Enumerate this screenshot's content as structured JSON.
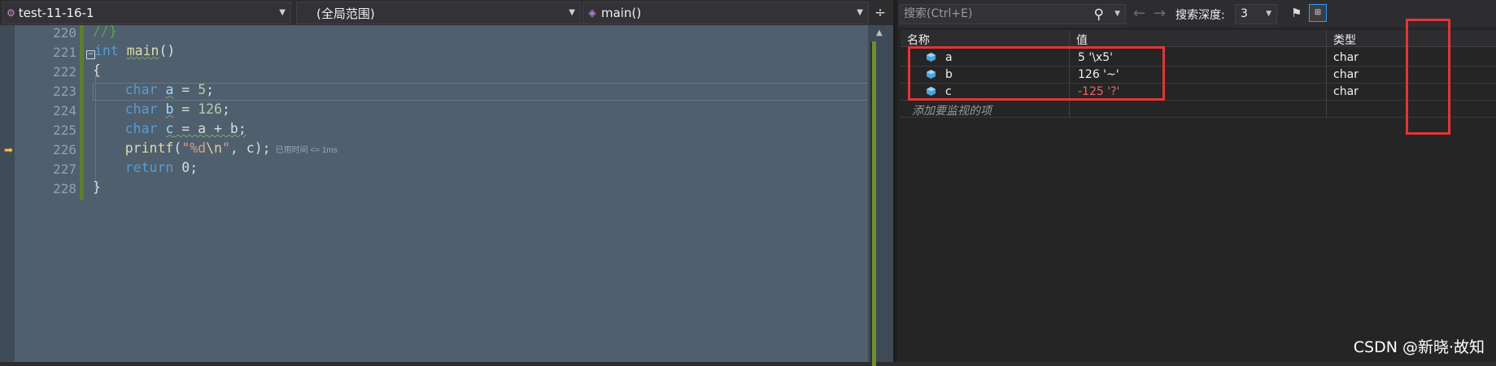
{
  "editor": {
    "project_combo": "test-11-16-1",
    "scope_combo": "(全局范围)",
    "function_combo": "main()",
    "line_numbers": [
      "220",
      "221",
      "222",
      "223",
      "224",
      "225",
      "226",
      "227",
      "228"
    ],
    "lines": {
      "l220": "//}",
      "l221_kw": "int",
      "l221_fn": "main",
      "l221_rest": "()",
      "l222": "{",
      "type_char": "char",
      "l223_var": "a",
      "l223_op": " = ",
      "l223_num": "5",
      "l224_var": "b",
      "l224_num": "126",
      "l225_var": "c",
      "l225_expr": " = a + b;",
      "l226_fn": "printf",
      "l226_open": "(",
      "l226_str1": "\"%d",
      "l226_esc": "\\n",
      "l226_str2": "\"",
      "l226_rest": ", c);",
      "l226_hint": "已用时间 <= 1ms",
      "l227_kw": "return",
      "l227_rest": " 0;",
      "l228": "}",
      "semicolon": ";"
    }
  },
  "watch": {
    "search_placeholder": "搜索(Ctrl+E)",
    "depth_label": "搜索深度:",
    "depth_value": "3",
    "columns": {
      "name": "名称",
      "value": "值",
      "type": "类型"
    },
    "rows": [
      {
        "name": "a",
        "value": "5 '\\x5'",
        "type": "char"
      },
      {
        "name": "b",
        "value": "126 '~'",
        "type": "char"
      },
      {
        "name": "c",
        "value": "-125 '?'",
        "type": "char",
        "value_color": "#f0646c"
      }
    ],
    "add_watch_placeholder": "添加要监视的项"
  },
  "watermark": "CSDN @新晓·故知",
  "colors": {
    "annotation_red": "#e33535",
    "change_green": "#5f7d2b",
    "keyword_blue": "#569cd6"
  }
}
